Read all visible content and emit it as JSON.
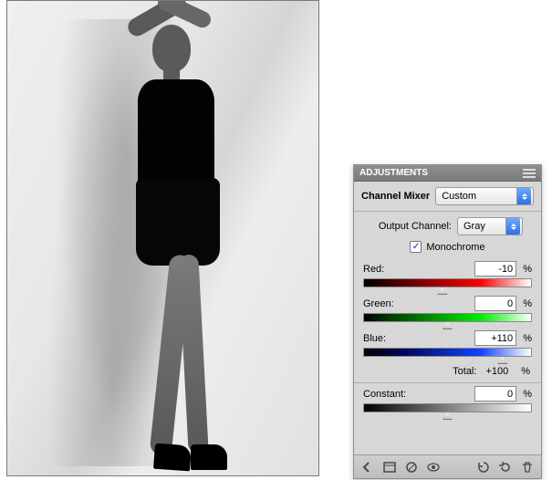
{
  "panel": {
    "title": "ADJUSTMENTS",
    "adjustment_label": "Channel Mixer",
    "preset": "Custom",
    "output_channel_label": "Output Channel:",
    "output_channel": "Gray",
    "monochrome_label": "Monochrome",
    "monochrome_checked": true,
    "sliders": {
      "red": {
        "label": "Red:",
        "value": "-10",
        "pos_pct": 47
      },
      "green": {
        "label": "Green:",
        "value": "0",
        "pos_pct": 50
      },
      "blue": {
        "label": "Blue:",
        "value": "+110",
        "pos_pct": 83
      }
    },
    "total_label": "Total:",
    "total_value": "+100",
    "constant": {
      "label": "Constant:",
      "value": "0",
      "pos_pct": 50
    },
    "percent": "%"
  },
  "icons": {
    "back": "back-arrow-icon",
    "expand": "expand-view-icon",
    "clip": "clip-to-layer-icon",
    "eye": "visibility-icon",
    "prev": "previous-state-icon",
    "reset": "reset-icon",
    "trash": "trash-icon"
  }
}
